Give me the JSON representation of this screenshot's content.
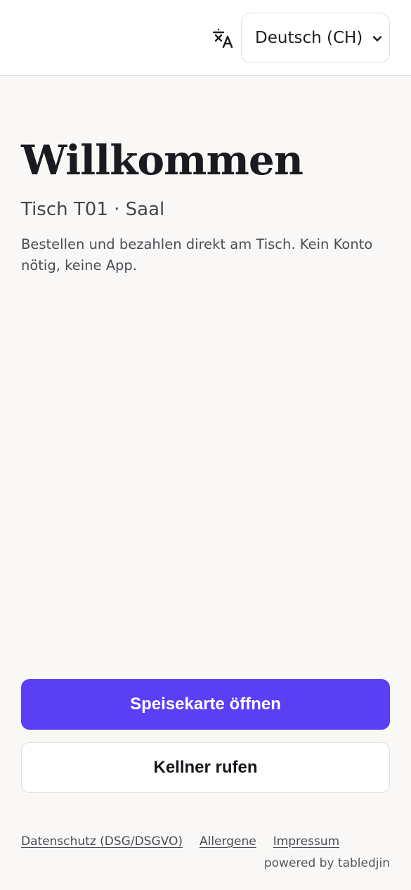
{
  "header": {
    "language_icon": "translate-icon",
    "language_select": {
      "selected": "Deutsch (CH)",
      "chevron_icon": "chevron-down-icon"
    }
  },
  "welcome": {
    "title": "Willkommen",
    "subtitle": "Tisch T01 · Saal",
    "description": "Bestellen und bezahlen direkt am Tisch. Kein Konto nötig, keine App."
  },
  "actions": {
    "open_menu_label": "Speisekarte öffnen",
    "call_waiter_label": "Kellner rufen"
  },
  "footer": {
    "links": [
      "Datenschutz (DSG/DSGVO)",
      "Allergene",
      "Impressum"
    ],
    "powered_by": "powered by tabledjin"
  },
  "colors": {
    "accent": "#5b3ff4",
    "background": "#f9f8f6",
    "header_background": "#ffffff"
  }
}
